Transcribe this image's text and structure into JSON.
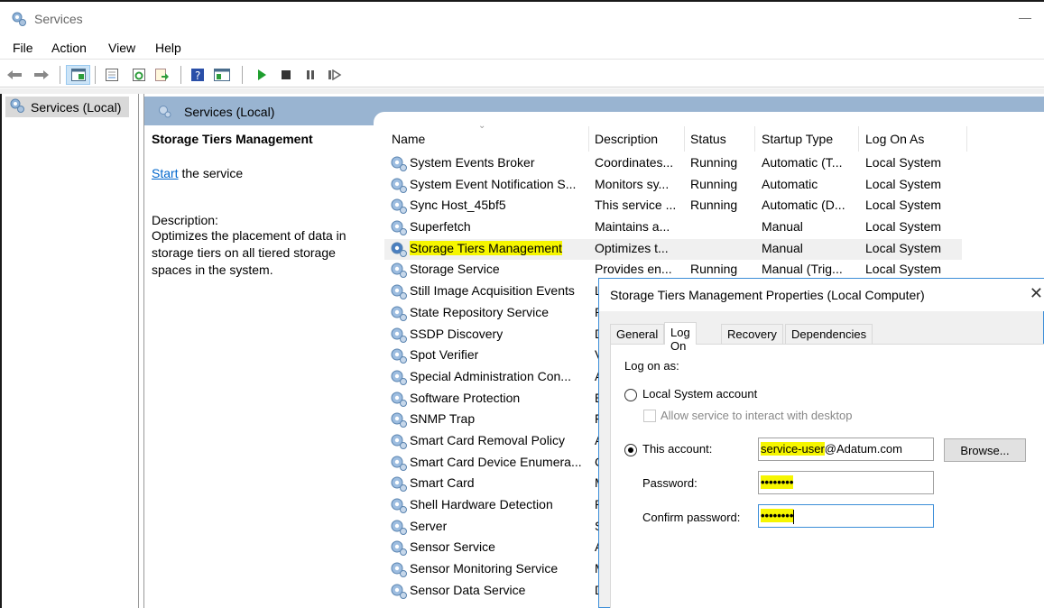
{
  "window": {
    "title": "Services",
    "icon": "services-gear-icon"
  },
  "menu": [
    "File",
    "Action",
    "View",
    "Help"
  ],
  "toolbar": {
    "buttons": [
      "back-arrow-icon",
      "forward-arrow-icon",
      "show-hide-console-tree-icon",
      "properties-icon",
      "refresh-icon",
      "export-list-icon",
      "help-icon",
      "show-action-pane-icon",
      "start-service-icon",
      "stop-service-icon",
      "pause-service-icon",
      "resume-service-icon"
    ]
  },
  "tree": {
    "root": "Services (Local)"
  },
  "main": {
    "header": "Services (Local)",
    "details": {
      "title": "Storage Tiers Management",
      "start_link": "Start",
      "start_suffix": " the service",
      "description_label": "Description:",
      "description": "Optimizes the placement of data in storage tiers on all tiered storage spaces in the system."
    },
    "columns": [
      "Name",
      "Description",
      "Status",
      "Startup Type",
      "Log On As"
    ],
    "rows": [
      {
        "name": "System Events Broker",
        "description": "Coordinates...",
        "status": "Running",
        "startup": "Automatic (T...",
        "logon": "Local System"
      },
      {
        "name": "System Event Notification S...",
        "description": "Monitors sy...",
        "status": "Running",
        "startup": "Automatic",
        "logon": "Local System"
      },
      {
        "name": "Sync Host_45bf5",
        "description": "This service ...",
        "status": "Running",
        "startup": "Automatic (D...",
        "logon": "Local System"
      },
      {
        "name": "Superfetch",
        "description": "Maintains a...",
        "status": "",
        "startup": "Manual",
        "logon": "Local System"
      },
      {
        "name": "Storage Tiers Management",
        "description": "Optimizes t...",
        "status": "",
        "startup": "Manual",
        "logon": "Local System",
        "selected": true
      },
      {
        "name": "Storage Service",
        "description": "Provides en...",
        "status": "Running",
        "startup": "Manual (Trig...",
        "logon": "Local System"
      },
      {
        "name": "Still Image Acquisition Events",
        "description": "L"
      },
      {
        "name": "State Repository Service",
        "description": "P"
      },
      {
        "name": "SSDP Discovery",
        "description": "D"
      },
      {
        "name": "Spot Verifier",
        "description": "V"
      },
      {
        "name": "Special Administration Con...",
        "description": "A"
      },
      {
        "name": "Software Protection",
        "description": "E"
      },
      {
        "name": "SNMP Trap",
        "description": "F"
      },
      {
        "name": "Smart Card Removal Policy",
        "description": "A"
      },
      {
        "name": "Smart Card Device Enumera...",
        "description": "C"
      },
      {
        "name": "Smart Card",
        "description": "M"
      },
      {
        "name": "Shell Hardware Detection",
        "description": "P"
      },
      {
        "name": "Server",
        "description": "S"
      },
      {
        "name": "Sensor Service",
        "description": "A"
      },
      {
        "name": "Sensor Monitoring Service",
        "description": "M"
      },
      {
        "name": "Sensor Data Service",
        "description": "D"
      }
    ]
  },
  "dialog": {
    "title": "Storage Tiers Management Properties (Local Computer)",
    "tabs": [
      "General",
      "Log On",
      "Recovery",
      "Dependencies"
    ],
    "active_tab": "Log On",
    "log_on_as": "Log on as:",
    "local_system": "Local System account",
    "allow_desktop": "Allow service to interact with desktop",
    "this_account": "This account:",
    "account_value_highlighted": "service-user",
    "account_value_rest": "@Adatum.com",
    "browse": "Browse...",
    "password_label": "Password:",
    "password_value": "••••••••",
    "confirm_label": "Confirm password:",
    "confirm_value": "••••••••",
    "highlight_color": "#f6f600"
  }
}
